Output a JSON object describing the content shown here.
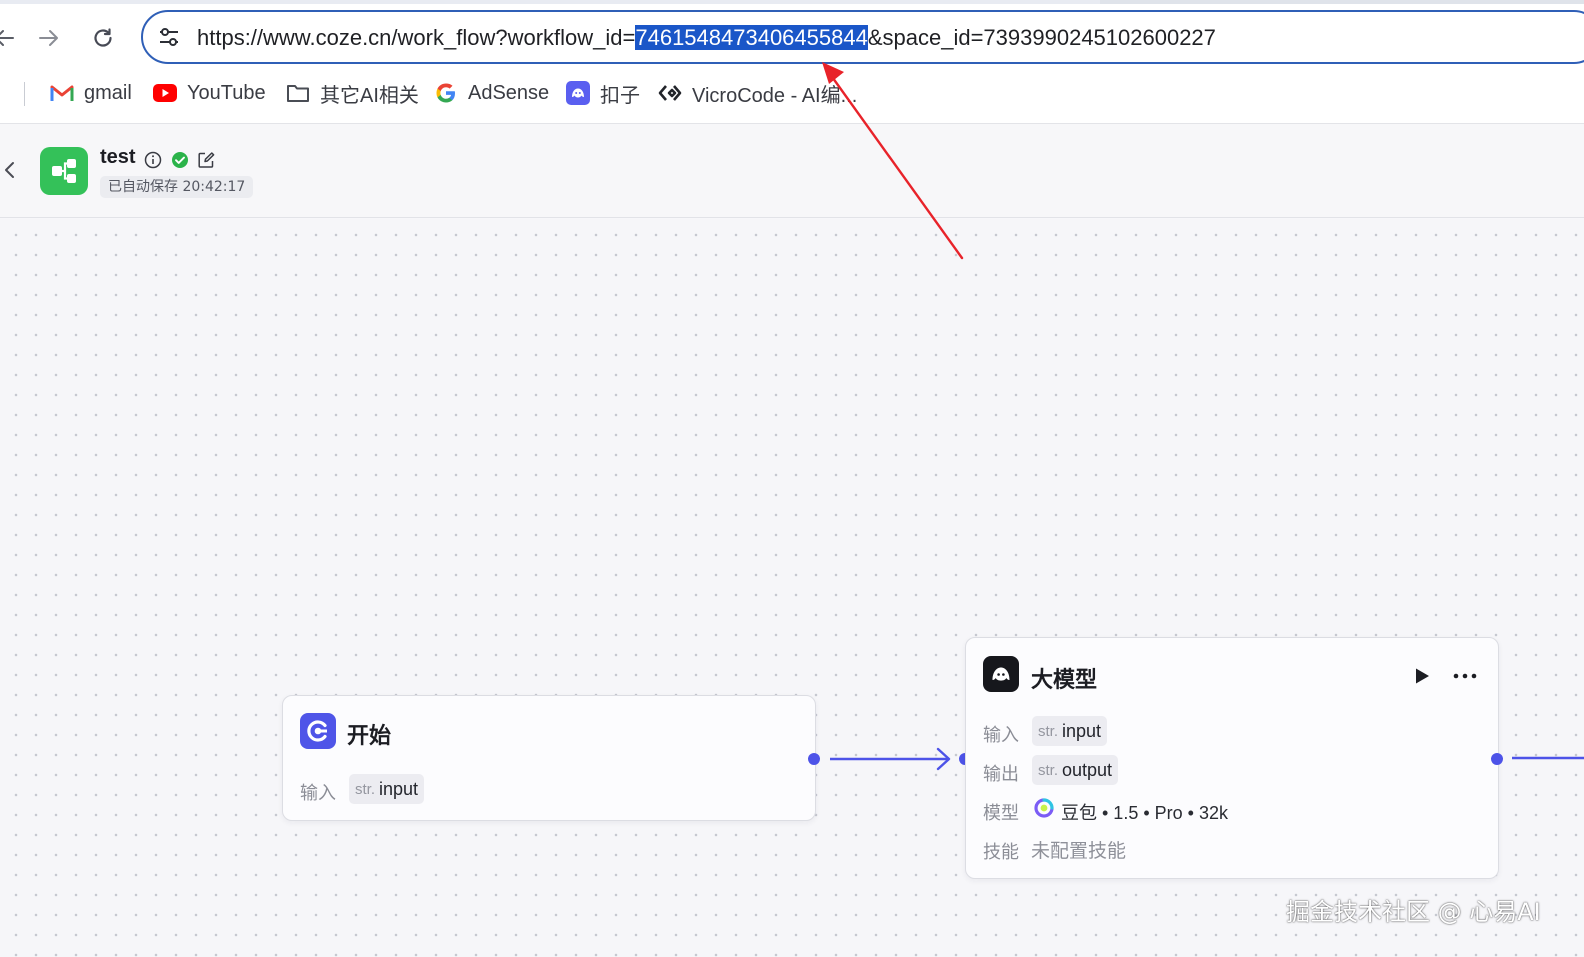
{
  "browser": {
    "url_prefix": "https://www.coze.cn/work_flow?workflow_id=",
    "url_selected": "7461548473406455844",
    "url_suffix": "&space_id=7393990245102600227",
    "bookmarks": [
      {
        "label": "gmail",
        "icon": "gmail-icon"
      },
      {
        "label": "YouTube",
        "icon": "youtube-icon"
      },
      {
        "label": "其它AI相关",
        "icon": "folder-icon"
      },
      {
        "label": "AdSense",
        "icon": "google-icon"
      },
      {
        "label": "扣子",
        "icon": "coze-icon"
      },
      {
        "label": "VicroCode - AI编...",
        "icon": "vicrocode-icon"
      }
    ]
  },
  "header": {
    "title": "test",
    "save_status": "已自动保存 20:42:17"
  },
  "nodes": {
    "start": {
      "title": "开始",
      "input_label": "输入",
      "input_type": "str.",
      "input_name": "input"
    },
    "llm": {
      "title": "大模型",
      "input_label": "输入",
      "input_type": "str.",
      "input_name": "input",
      "output_label": "输出",
      "output_type": "str.",
      "output_name": "output",
      "model_label": "模型",
      "model_value": "豆包 • 1.5 • Pro • 32k",
      "skill_label": "技能",
      "skill_value": "未配置技能"
    }
  },
  "watermark": "掘金技术社区 @ 心易AI",
  "colors": {
    "accent": "#4d53e8",
    "annotation_arrow": "#e8232a",
    "selection": "#1a56c8",
    "workflow_icon": "#34c159"
  }
}
